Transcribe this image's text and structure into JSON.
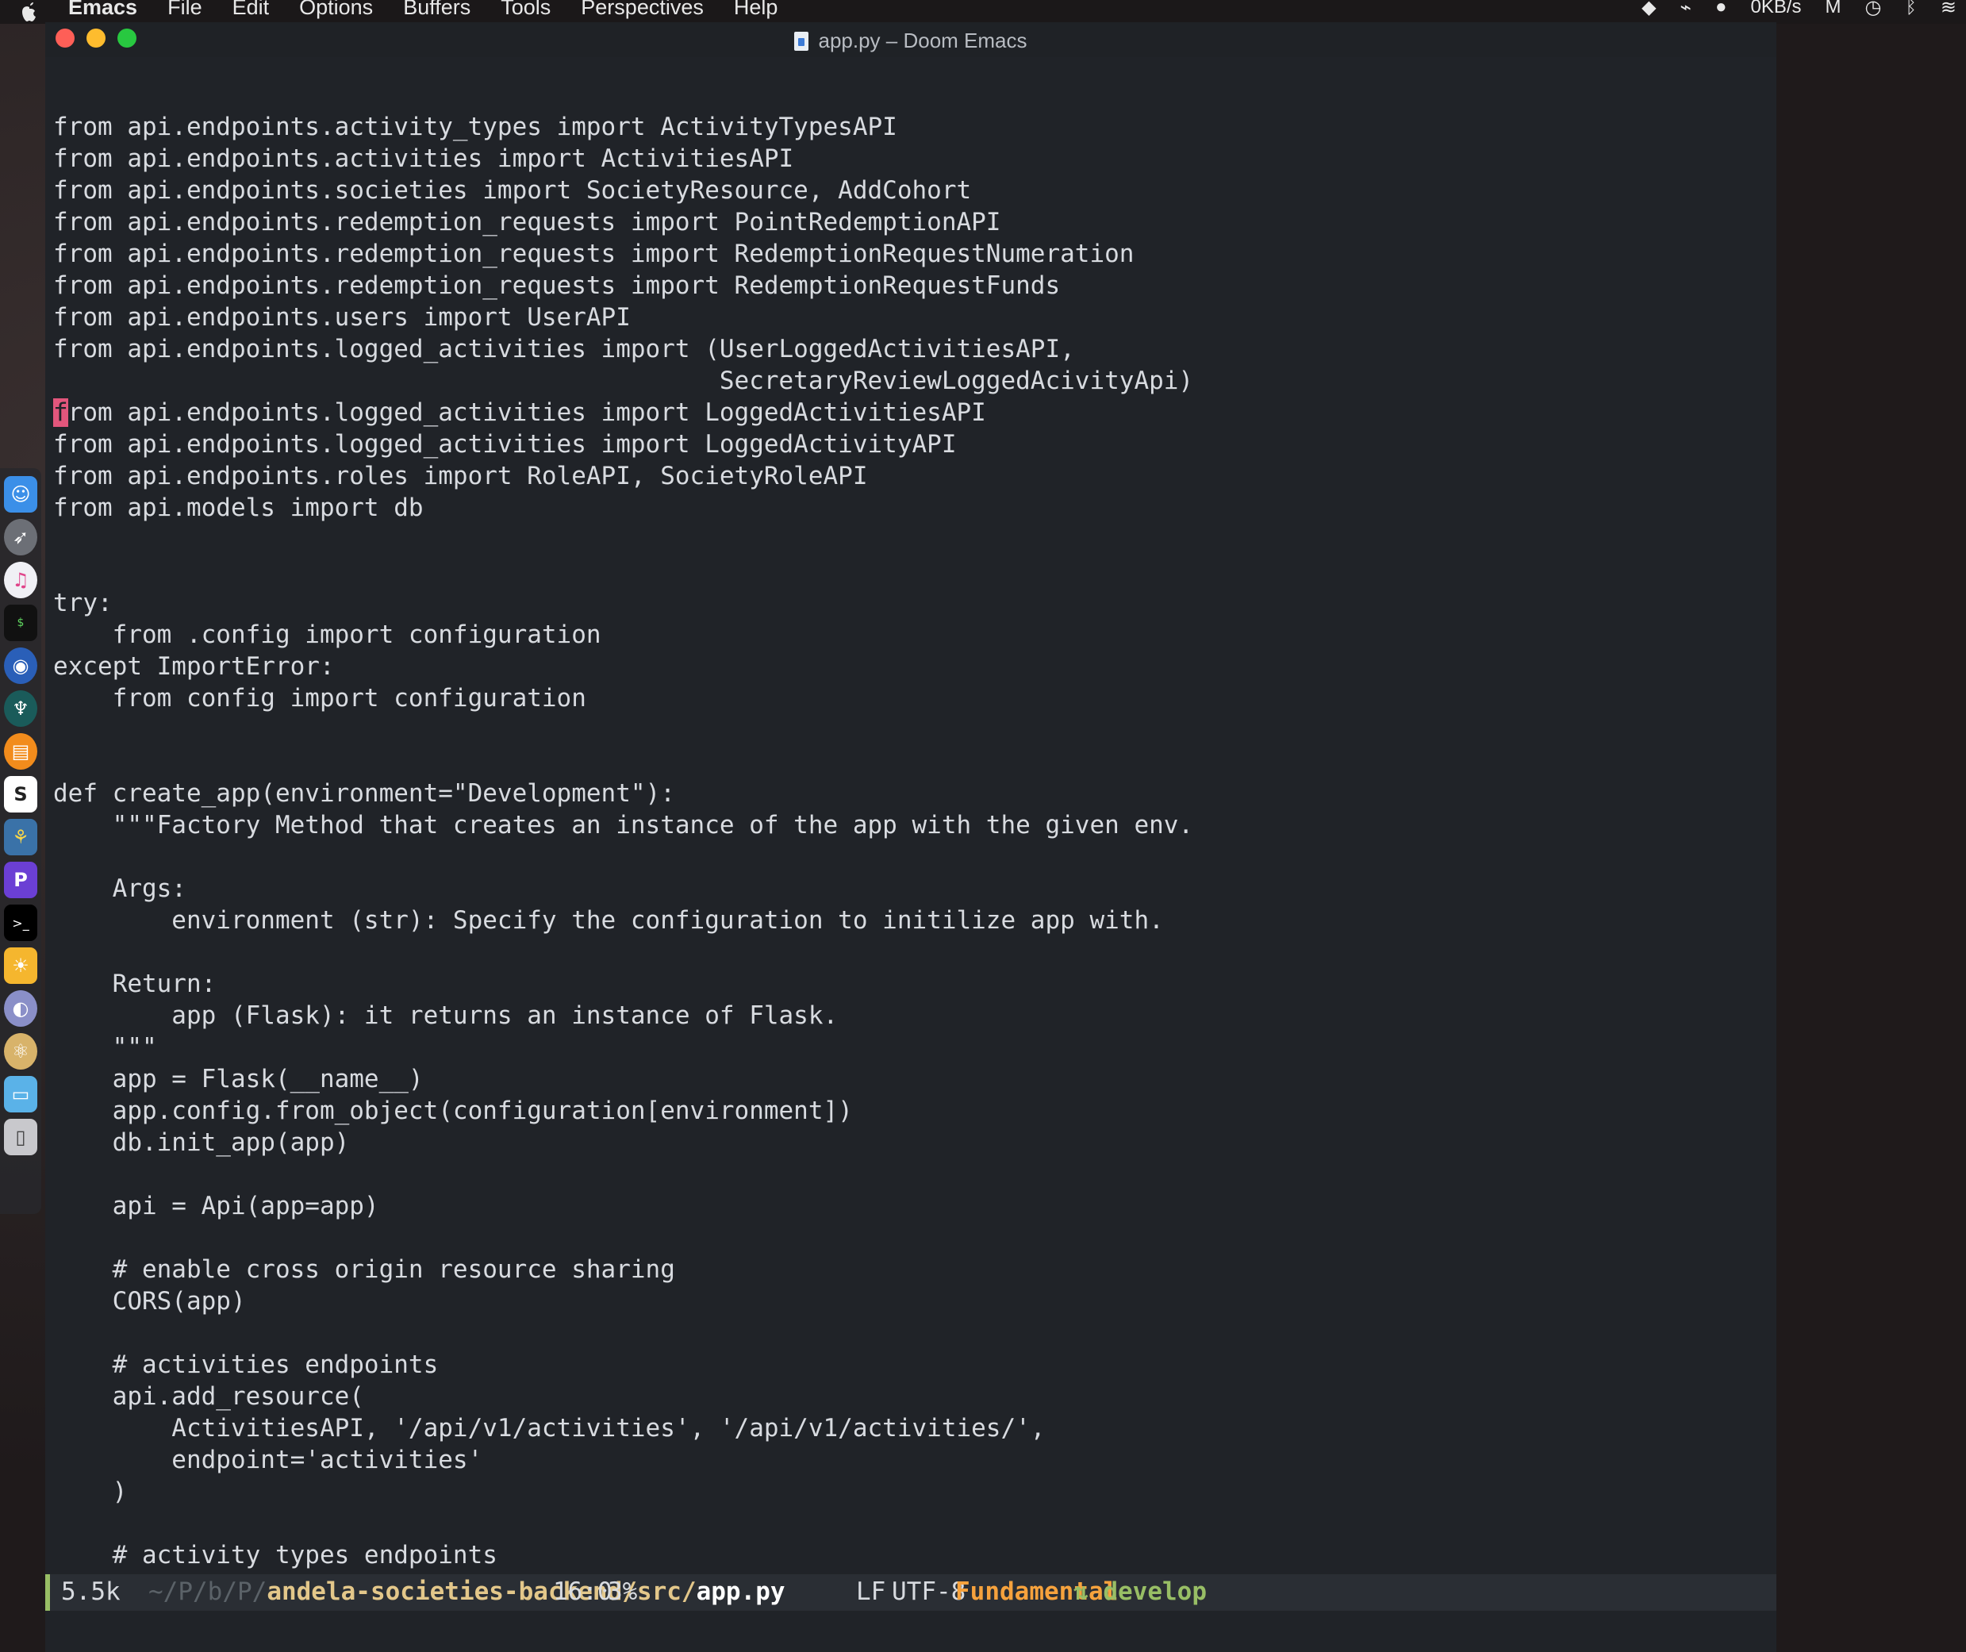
{
  "menubar": {
    "items": [
      "Emacs",
      "File",
      "Edit",
      "Options",
      "Buffers",
      "Tools",
      "Perspectives",
      "Help"
    ],
    "right_status": {
      "network_speed": "0KB/s"
    }
  },
  "window": {
    "title": "app.py – Doom Emacs"
  },
  "editor": {
    "lines": [
      "from api.endpoints.activity_types import ActivityTypesAPI",
      "from api.endpoints.activities import ActivitiesAPI",
      "from api.endpoints.societies import SocietyResource, AddCohort",
      "from api.endpoints.redemption_requests import PointRedemptionAPI",
      "from api.endpoints.redemption_requests import RedemptionRequestNumeration",
      "from api.endpoints.redemption_requests import RedemptionRequestFunds",
      "from api.endpoints.users import UserAPI",
      "from api.endpoints.logged_activities import (UserLoggedActivitiesAPI,",
      "                                             SecretaryReviewLoggedAcivityApi)",
      "from api.endpoints.logged_activities import LoggedActivitiesAPI",
      "from api.endpoints.logged_activities import LoggedActivityAPI",
      "from api.endpoints.roles import RoleAPI, SocietyRoleAPI",
      "from api.models import db",
      "",
      "",
      "try:",
      "    from .config import configuration",
      "except ImportError:",
      "    from config import configuration",
      "",
      "",
      "def create_app(environment=\"Development\"):",
      "    \"\"\"Factory Method that creates an instance of the app with the given env.",
      "",
      "    Args:",
      "        environment (str): Specify the configuration to initilize app with.",
      "",
      "    Return:",
      "        app (Flask): it returns an instance of Flask.",
      "    \"\"\"",
      "    app = Flask(__name__)",
      "    app.config.from_object(configuration[environment])",
      "    db.init_app(app)",
      "",
      "    api = Api(app=app)",
      "",
      "    # enable cross origin resource sharing",
      "    CORS(app)",
      "",
      "    # activities endpoints",
      "    api.add_resource(",
      "        ActivitiesAPI, '/api/v1/activities', '/api/v1/activities/',",
      "        endpoint='activities'",
      "    )",
      "",
      "    # activity types endpoints",
      "    api.add_resource("
    ],
    "cursor_line": 9
  },
  "modeline": {
    "buffer_size": "5.5k",
    "path_dirs": "~/P/b/P/",
    "project": "andela-societies-backend/src/",
    "filename": "app.py",
    "position": "16:0",
    "percent": "3%",
    "eol": "LF",
    "encoding": "UTF-8",
    "major_mode": "Fundamental",
    "branch": "develop",
    "colors": {
      "accent": "#98be65",
      "mode": "#f6a23d",
      "project": "#e3c78a"
    }
  },
  "dock": {
    "icons": [
      "finder-icon",
      "launchpad-icon",
      "itunes-icon",
      "terminal-mini-icon",
      "firefox-icon",
      "gitkraken-icon",
      "books-icon",
      "slack-icon",
      "python-icon",
      "pycharm-icon",
      "terminal-icon",
      "idea-icon",
      "pockity-icon",
      "atom-icon",
      "folder-icon",
      "trash-icon"
    ]
  }
}
